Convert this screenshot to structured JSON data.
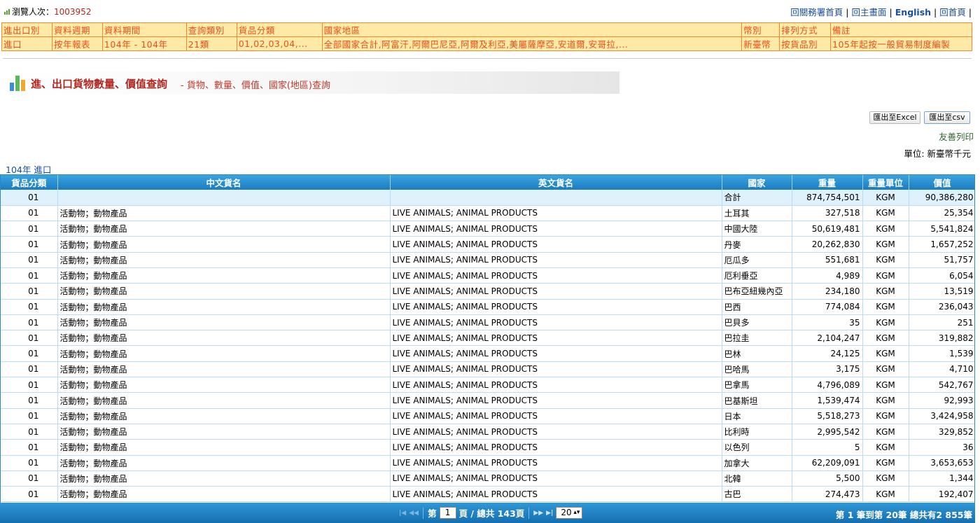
{
  "visitor": {
    "label": "瀏覽人次：",
    "count": "1003952"
  },
  "top_links": [
    "回關務署首頁",
    "回主畫面",
    "English",
    "回首頁"
  ],
  "criteria": {
    "headers": [
      "進出口別",
      "資料週期",
      "資料期間",
      "查詢類別",
      "貨品分類",
      "國家地區",
      "幣別",
      "排列方式",
      "備註"
    ],
    "values": [
      "進口",
      "按年報表",
      "104年 - 104年",
      "21類",
      "01,02,03,04,...",
      "全部國家合計,阿富汗,阿爾巴尼亞,阿爾及利亞,美屬薩摩亞,安道爾,安哥拉,...",
      "新臺幣",
      "按貨品別",
      "105年起按一般貿易制度編製"
    ]
  },
  "section": {
    "title": "進、出口貨物數量、價值查詢",
    "subtitle": "- 貨物、數量、價值、國家(地區)查詢"
  },
  "buttons": {
    "excel": "匯出至Excel",
    "csv": "匯出至csv"
  },
  "print_label": "友善列印",
  "unit_label": "單位: 新臺幣千元",
  "table_caption": "104年 進口",
  "table": {
    "columns": [
      "貨品分類",
      "中文貨名",
      "英文貨名",
      "國家",
      "重量",
      "重量單位",
      "價值"
    ],
    "rows": [
      [
        "01",
        "",
        "",
        "合計",
        "874,754,501",
        "KGM",
        "90,386,280"
      ],
      [
        "01",
        "活動物；動物產品",
        "LIVE ANIMALS; ANIMAL PRODUCTS",
        "土耳其",
        "327,518",
        "KGM",
        "25,354"
      ],
      [
        "01",
        "活動物；動物產品",
        "LIVE ANIMALS; ANIMAL PRODUCTS",
        "中國大陸",
        "50,619,481",
        "KGM",
        "5,541,824"
      ],
      [
        "01",
        "活動物；動物產品",
        "LIVE ANIMALS; ANIMAL PRODUCTS",
        "丹麥",
        "20,262,830",
        "KGM",
        "1,657,252"
      ],
      [
        "01",
        "活動物；動物產品",
        "LIVE ANIMALS; ANIMAL PRODUCTS",
        "厄瓜多",
        "551,681",
        "KGM",
        "51,757"
      ],
      [
        "01",
        "活動物；動物產品",
        "LIVE ANIMALS; ANIMAL PRODUCTS",
        "厄利垂亞",
        "4,989",
        "KGM",
        "6,054"
      ],
      [
        "01",
        "活動物；動物產品",
        "LIVE ANIMALS; ANIMAL PRODUCTS",
        "巴布亞紐幾內亞",
        "234,180",
        "KGM",
        "13,519"
      ],
      [
        "01",
        "活動物；動物產品",
        "LIVE ANIMALS; ANIMAL PRODUCTS",
        "巴西",
        "774,084",
        "KGM",
        "236,043"
      ],
      [
        "01",
        "活動物；動物產品",
        "LIVE ANIMALS; ANIMAL PRODUCTS",
        "巴貝多",
        "35",
        "KGM",
        "251"
      ],
      [
        "01",
        "活動物；動物產品",
        "LIVE ANIMALS; ANIMAL PRODUCTS",
        "巴拉圭",
        "2,104,247",
        "KGM",
        "319,882"
      ],
      [
        "01",
        "活動物；動物產品",
        "LIVE ANIMALS; ANIMAL PRODUCTS",
        "巴林",
        "24,125",
        "KGM",
        "1,539"
      ],
      [
        "01",
        "活動物；動物產品",
        "LIVE ANIMALS; ANIMAL PRODUCTS",
        "巴哈馬",
        "3,175",
        "KGM",
        "4,710"
      ],
      [
        "01",
        "活動物；動物產品",
        "LIVE ANIMALS; ANIMAL PRODUCTS",
        "巴拿馬",
        "4,796,089",
        "KGM",
        "542,767"
      ],
      [
        "01",
        "活動物；動物產品",
        "LIVE ANIMALS; ANIMAL PRODUCTS",
        "巴基斯坦",
        "1,539,474",
        "KGM",
        "92,993"
      ],
      [
        "01",
        "活動物；動物產品",
        "LIVE ANIMALS; ANIMAL PRODUCTS",
        "日本",
        "5,518,273",
        "KGM",
        "3,424,958"
      ],
      [
        "01",
        "活動物；動物產品",
        "LIVE ANIMALS; ANIMAL PRODUCTS",
        "比利時",
        "2,995,542",
        "KGM",
        "329,852"
      ],
      [
        "01",
        "活動物；動物產品",
        "LIVE ANIMALS; ANIMAL PRODUCTS",
        "以色列",
        "5",
        "KGM",
        "36"
      ],
      [
        "01",
        "活動物；動物產品",
        "LIVE ANIMALS; ANIMAL PRODUCTS",
        "加拿大",
        "62,209,091",
        "KGM",
        "3,653,653"
      ],
      [
        "01",
        "活動物；動物產品",
        "LIVE ANIMALS; ANIMAL PRODUCTS",
        "北韓",
        "5,500",
        "KGM",
        "1,344"
      ],
      [
        "01",
        "活動物；動物產品",
        "LIVE ANIMALS; ANIMAL PRODUCTS",
        "古巴",
        "274,473",
        "KGM",
        "192,407"
      ]
    ]
  },
  "pager": {
    "page_prefix": "第",
    "page_value": "1",
    "page_suffix": "頁 / 總共 143頁",
    "page_size": "20",
    "summary": "第 1 筆到第 20筆 總共有2 855筆"
  },
  "colors": {
    "accent_blue": "#1b7cc0",
    "criteria_bg": "#ffe9a6",
    "criteria_text": "#e8501a",
    "title_red": "#b3261e"
  }
}
